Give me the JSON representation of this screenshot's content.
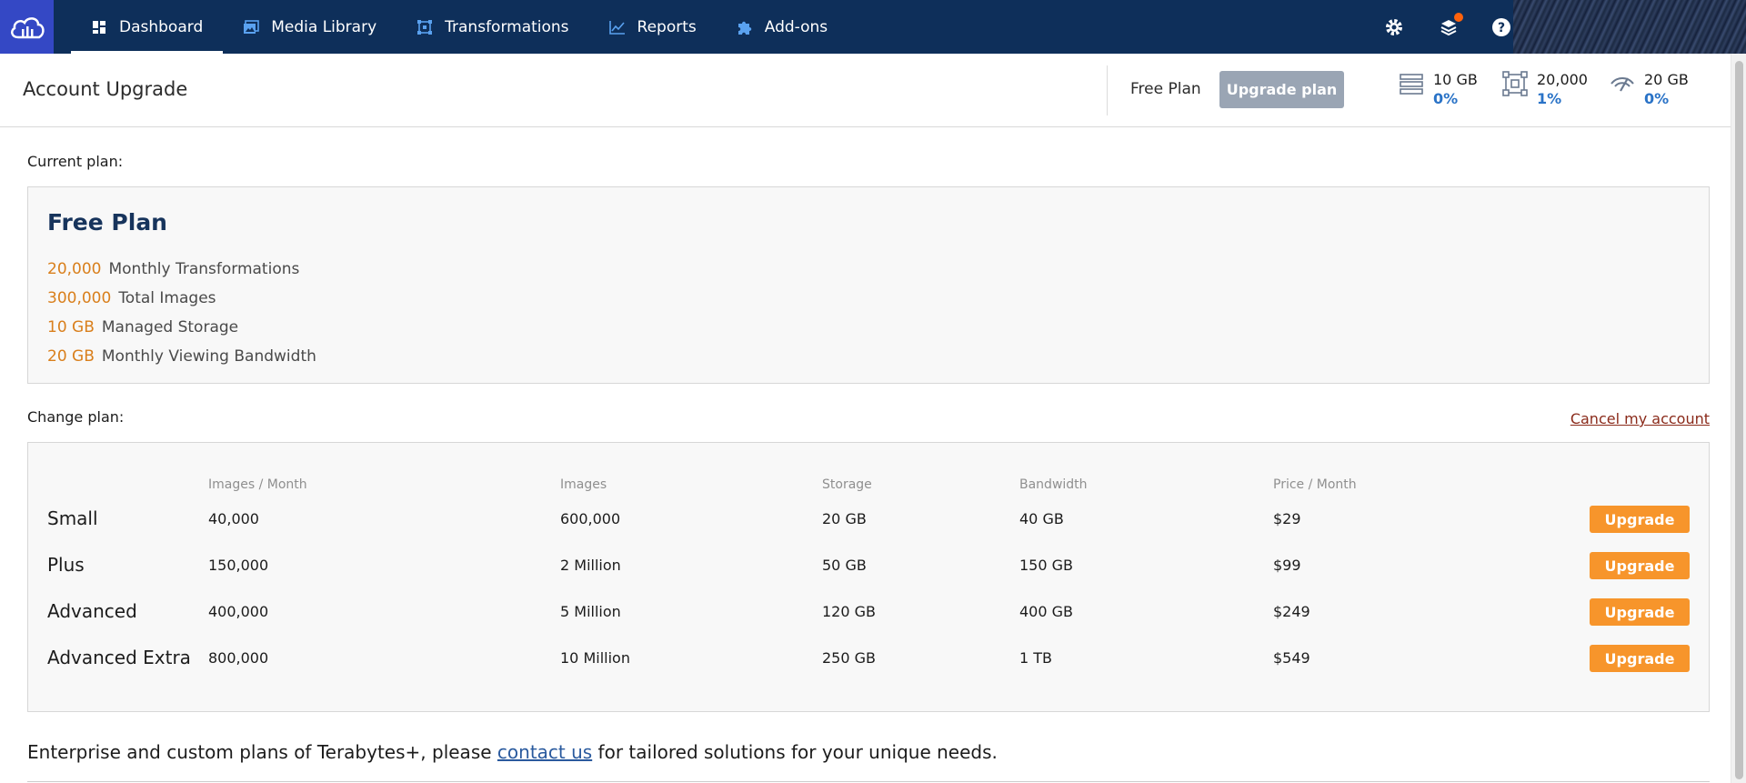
{
  "nav": {
    "items": [
      {
        "label": "Dashboard",
        "icon": "dashboard-icon",
        "active": true
      },
      {
        "label": "Media Library",
        "icon": "media-library-icon"
      },
      {
        "label": "Transformations",
        "icon": "transformations-icon"
      },
      {
        "label": "Reports",
        "icon": "reports-icon"
      },
      {
        "label": "Add-ons",
        "icon": "puzzle-icon"
      }
    ],
    "right_icons": [
      "gear-icon",
      "notifications-icon",
      "help-icon"
    ],
    "accent": "#0e2f5a",
    "logo_bg": "#3448c5"
  },
  "header": {
    "title": "Account Upgrade",
    "plan_name": "Free Plan",
    "upgrade_button": "Upgrade plan",
    "usage": [
      {
        "icon": "storage-icon",
        "value": "10 GB",
        "percent": "0%"
      },
      {
        "icon": "transformations-quota-icon",
        "value": "20,000",
        "percent": "1%"
      },
      {
        "icon": "bandwidth-icon",
        "value": "20 GB",
        "percent": "0%"
      }
    ]
  },
  "current": {
    "label": "Current plan:",
    "title": "Free Plan",
    "features": [
      {
        "value": "20,000",
        "text": "Monthly Transformations"
      },
      {
        "value": "300,000",
        "text": "Total Images"
      },
      {
        "value": "10 GB",
        "text": "Managed Storage"
      },
      {
        "value": "20 GB",
        "text": "Monthly Viewing Bandwidth"
      }
    ]
  },
  "change": {
    "label": "Change plan:",
    "cancel_link": "Cancel my account",
    "columns": [
      "Images / Month",
      "Images",
      "Storage",
      "Bandwidth",
      "Price / Month"
    ],
    "plans": [
      {
        "name": "Small",
        "images_month": "40,000",
        "images": "600,000",
        "storage": "20 GB",
        "bandwidth": "40 GB",
        "price": "$29",
        "button": "Upgrade"
      },
      {
        "name": "Plus",
        "images_month": "150,000",
        "images": "2 Million",
        "storage": "50 GB",
        "bandwidth": "150 GB",
        "price": "$99",
        "button": "Upgrade"
      },
      {
        "name": "Advanced",
        "images_month": "400,000",
        "images": "5 Million",
        "storage": "120 GB",
        "bandwidth": "400 GB",
        "price": "$249",
        "button": "Upgrade"
      },
      {
        "name": "Advanced Extra",
        "images_month": "800,000",
        "images": "10 Million",
        "storage": "250 GB",
        "bandwidth": "1 TB",
        "price": "$549",
        "button": "Upgrade"
      }
    ],
    "button_color": "#f7952b"
  },
  "footer": {
    "before": "Enterprise and custom plans of Terabytes+, please ",
    "link": "contact us",
    "after": " for tailored solutions for your unique needs."
  }
}
